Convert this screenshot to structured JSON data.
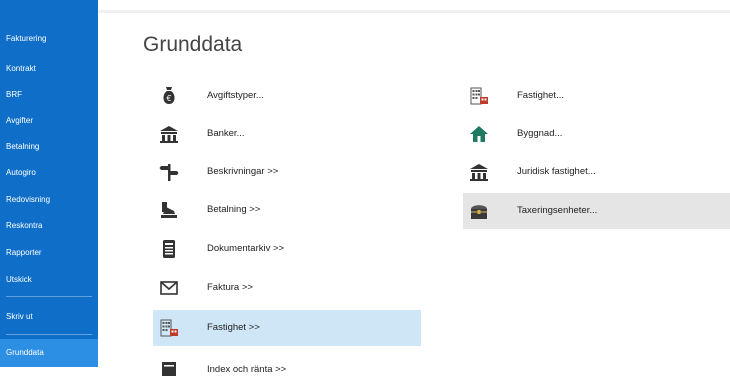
{
  "sidebar": {
    "items": [
      {
        "label": "Fakturering"
      },
      {
        "label": "Kontrakt"
      },
      {
        "label": "BRF"
      },
      {
        "label": "Avgifter"
      },
      {
        "label": "Betalning"
      },
      {
        "label": "Autogiro"
      },
      {
        "label": "Redovisning"
      },
      {
        "label": "Reskontra"
      },
      {
        "label": "Rapporter"
      },
      {
        "label": "Utskick"
      },
      {
        "label": "Skriv ut"
      },
      {
        "label": "Grunddata"
      }
    ]
  },
  "main": {
    "title": "Grunddata",
    "left_items": [
      {
        "label": "Avgiftstyper...",
        "icon": "money-bag-euro-icon"
      },
      {
        "label": "Banker...",
        "icon": "bank-icon"
      },
      {
        "label": "Beskrivningar >>",
        "icon": "signpost-icon"
      },
      {
        "label": "Betalning >>",
        "icon": "payment-icon"
      },
      {
        "label": "Dokumentarkiv >>",
        "icon": "document-archive-icon"
      },
      {
        "label": "Faktura >>",
        "icon": "envelope-icon"
      },
      {
        "label": "Fastighet >>",
        "icon": "building-icon"
      },
      {
        "label": "Index och ränta >>",
        "icon": "index-icon"
      }
    ],
    "right_items": [
      {
        "label": "Fastighet...",
        "icon": "building-icon"
      },
      {
        "label": "Byggnad...",
        "icon": "house-icon"
      },
      {
        "label": "Juridisk fastighet...",
        "icon": "bank-icon"
      },
      {
        "label": "Taxeringsenheter...",
        "icon": "treasure-chest-icon"
      }
    ]
  },
  "colors": {
    "sidebar_bg": "#0f6fc8",
    "sidebar_active": "#2c8fe4",
    "highlight_blue": "#cfe6f7",
    "highlight_gray": "#e5e5e5"
  }
}
